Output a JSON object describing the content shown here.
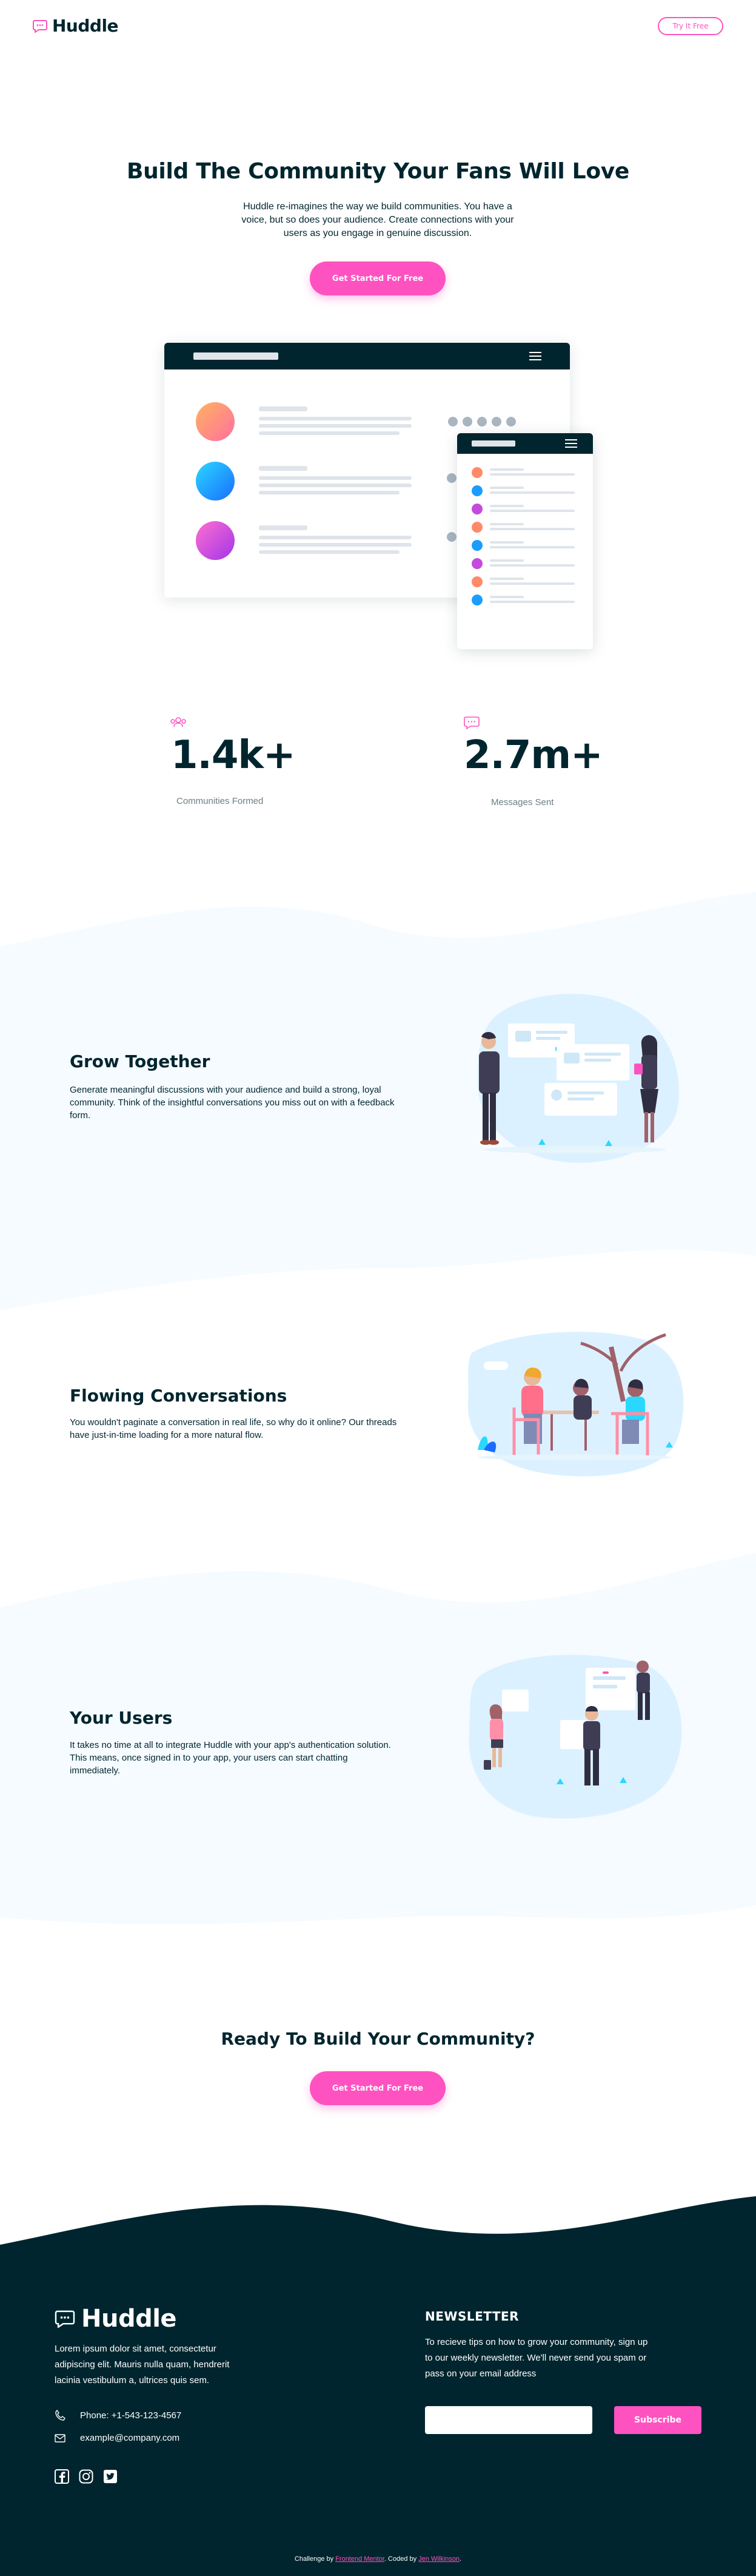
{
  "header": {
    "logo_text": "Huddle",
    "try_button": "Try It Free"
  },
  "hero": {
    "title": "Build The Community Your Fans Will Love",
    "text": "Huddle re-imagines the way we build communities. You have a voice, but so does your audience. Create connections with your users as you engage in genuine discussion.",
    "cta": "Get Started For Free"
  },
  "stats": [
    {
      "icon": "communities-icon",
      "value": "1.4k+",
      "label": "Communities Formed"
    },
    {
      "icon": "messages-icon",
      "value": "2.7m+",
      "label": "Messages Sent"
    }
  ],
  "features": [
    {
      "title": "Grow Together",
      "text": "Generate meaningful discussions with your audience and build a strong, loyal community. Think of the insightful conversations you miss out on with a feedback form."
    },
    {
      "title": "Flowing Conversations",
      "text": "You wouldn't paginate a conversation in real life, so why do it online? Our threads have just-in-time loading for a more natural flow."
    },
    {
      "title": "Your Users",
      "text": "It takes no time at all to integrate Huddle with your app's authentication solution. This means, once signed in to your app, your users can start chatting immediately."
    }
  ],
  "cta": {
    "title": "Ready To Build Your Community?",
    "button": "Get Started For Free"
  },
  "footer": {
    "logo_text": "Huddle",
    "about": "Lorem ipsum dolor sit amet, consectetur adipiscing elit. Mauris nulla quam, hendrerit lacinia vestibulum a, ultrices quis sem.",
    "phone": "Phone: +1-543-123-4567",
    "email": "example@company.com",
    "social": [
      "facebook-icon",
      "instagram-icon",
      "twitter-icon"
    ],
    "newsletter_title": "NEWSLETTER",
    "newsletter_text": "To recieve tips on how to grow your community, sign up to our weekly newsletter. We'll never send you spam or pass on your email address",
    "input_placeholder": "",
    "subscribe_button": "Subscribe",
    "attribution_prefix": "Challenge by",
    "attribution_fm": "Frontend Mentor",
    "attribution_mid": ". Coded by",
    "attribution_author": "Jen Wilkinson",
    "attribution_end": "."
  },
  "colors": {
    "primary": "#ff52c1",
    "dark": "#00252e",
    "pale_blue": "#f5fbff"
  }
}
